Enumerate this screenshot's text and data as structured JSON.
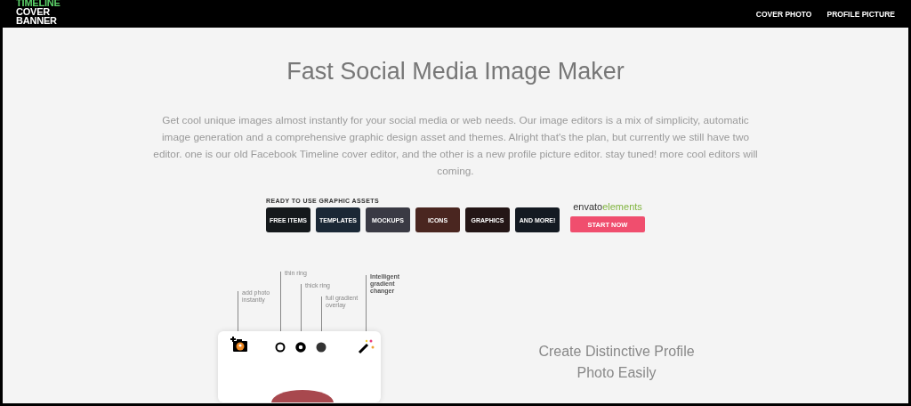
{
  "header": {
    "logo": [
      "TIMELINE",
      "COVER",
      "BANNER"
    ],
    "nav": [
      {
        "label": "COVER PHOTO"
      },
      {
        "label": "PROFILE PICTURE"
      }
    ]
  },
  "hero": {
    "title": "Fast Social Media Image Maker",
    "description": "Get cool unique images almost instantly for your social media or web needs. Our image editors is a mix of simplicity, automatic image generation and a comprehensive graphic design asset and themes. Alright that's the plan, but currently we still have two editor. one is our old Facebook Timeline cover editor, and the other is a new profile picture editor. stay tuned! more cool editors will coming."
  },
  "ad": {
    "heading": "READY TO USE GRAPHIC ASSETS",
    "tiles": [
      {
        "label": "FREE ITEMS",
        "color": "#15191c"
      },
      {
        "label": "TEMPLATES",
        "color": "#1b2836"
      },
      {
        "label": "MOCKUPS",
        "color": "#3a3a44"
      },
      {
        "label": "ICONS",
        "color": "#4a2620"
      },
      {
        "label": "GRAPHICS",
        "color": "#241616"
      },
      {
        "label": "AND MORE!",
        "color": "#141a22"
      }
    ],
    "brand": "envato",
    "brand_suffix": "elements",
    "button": "START NOW"
  },
  "editor_preview": {
    "tools": [
      {
        "kind": "camera",
        "note": "add photo instantly"
      },
      {
        "kind": "thin-ring",
        "note": "thin ring"
      },
      {
        "kind": "thick-ring",
        "note": "thick ring"
      },
      {
        "kind": "filled",
        "note": "full gradient overlay"
      },
      {
        "kind": "wand",
        "note": "Intelligent gradient changer"
      }
    ]
  },
  "feature": {
    "title": "Create Distinctive Profile Photo Easily"
  }
}
